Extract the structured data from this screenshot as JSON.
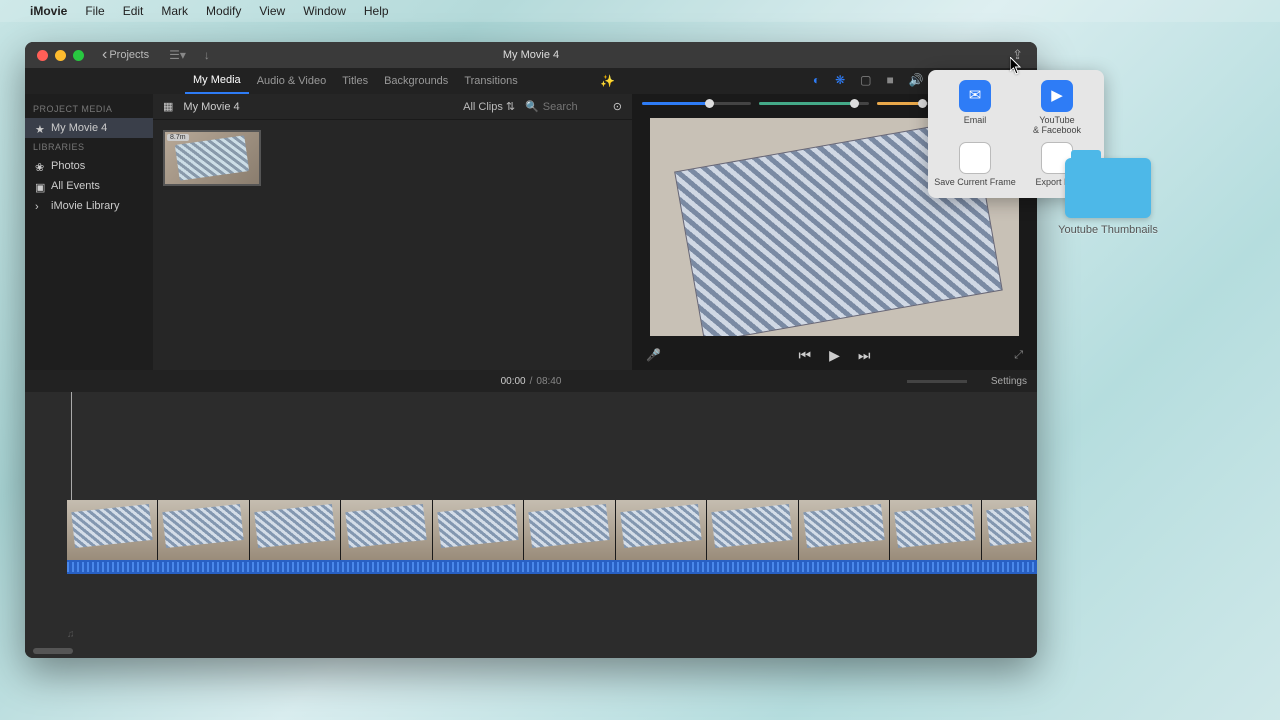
{
  "menubar": {
    "app": "iMovie",
    "items": [
      "File",
      "Edit",
      "Mark",
      "Modify",
      "View",
      "Window",
      "Help"
    ]
  },
  "titlebar": {
    "back": "Projects",
    "title": "My Movie 4"
  },
  "tabs": [
    "My Media",
    "Audio & Video",
    "Titles",
    "Backgrounds",
    "Transitions"
  ],
  "sidebar": {
    "section1": "PROJECT MEDIA",
    "project": "My Movie 4",
    "section2": "LIBRARIES",
    "photos": "Photos",
    "allevents": "All Events",
    "library": "iMovie Library"
  },
  "media": {
    "title": "My Movie 4",
    "allclips": "All Clips",
    "search_placeholder": "Search",
    "thumb_badge": "8.7m"
  },
  "time": {
    "current": "00:00",
    "sep": "/",
    "total": "08:40",
    "settings": "Settings"
  },
  "popover": {
    "email": "Email",
    "youtube_line1": "YouTube",
    "youtube_line2": "& Facebook",
    "saveframe": "Save Current Frame",
    "export": "Export File"
  },
  "desktop_folder": "Youtube Thumbnails"
}
